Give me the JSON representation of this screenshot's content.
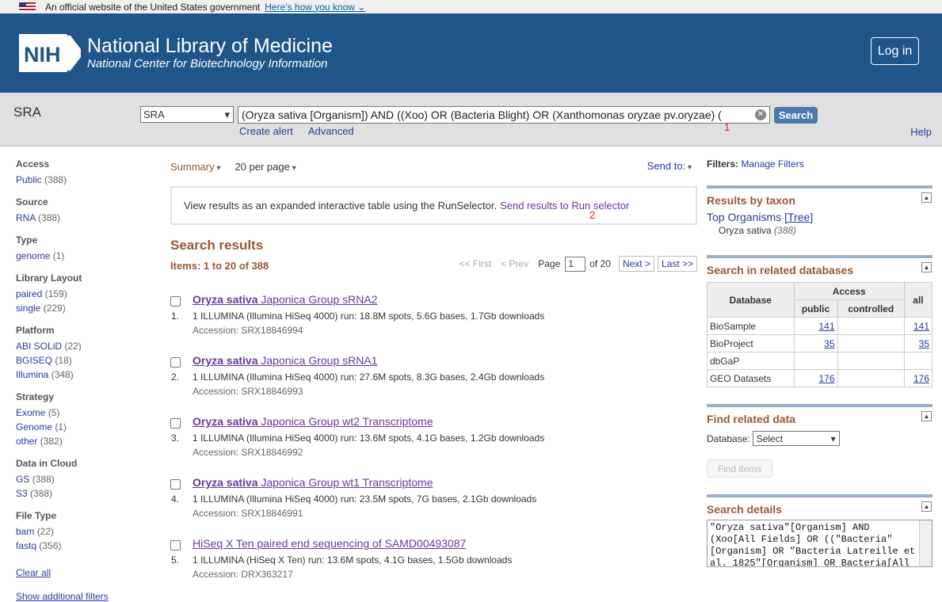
{
  "gov_banner": {
    "text": "An official website of the United States government",
    "link": "Here's how you know"
  },
  "header": {
    "logo_text": "NIH",
    "title": "National Library of Medicine",
    "subtitle": "National Center for Biotechnology Information",
    "login": "Log in"
  },
  "search": {
    "db_label": "SRA",
    "db_selected": "SRA",
    "term": "(Oryza sativa [Organism]) AND ((Xoo) OR (Bacteria Blight) OR (Xanthomonas oryzae pv.oryzae) (",
    "button": "Search",
    "create_alert": "Create alert",
    "advanced": "Advanced",
    "help": "Help",
    "marker1": "1",
    "marker2": "2"
  },
  "filters": [
    {
      "heading": "Access",
      "items": [
        {
          "label": "Public",
          "count": "(388)"
        }
      ]
    },
    {
      "heading": "Source",
      "items": [
        {
          "label": "RNA",
          "count": "(388)"
        }
      ]
    },
    {
      "heading": "Type",
      "items": [
        {
          "label": "genome",
          "count": "(1)"
        }
      ]
    },
    {
      "heading": "Library Layout",
      "items": [
        {
          "label": "paired",
          "count": "(159)"
        },
        {
          "label": "single",
          "count": "(229)"
        }
      ]
    },
    {
      "heading": "Platform",
      "items": [
        {
          "label": "ABI SOLiD",
          "count": "(22)"
        },
        {
          "label": "BGISEQ",
          "count": "(18)"
        },
        {
          "label": "Illumina",
          "count": "(348)"
        }
      ]
    },
    {
      "heading": "Strategy",
      "items": [
        {
          "label": "Exome",
          "count": "(5)"
        },
        {
          "label": "Genome",
          "count": "(1)"
        },
        {
          "label": "other",
          "count": "(382)"
        }
      ]
    },
    {
      "heading": "Data in Cloud",
      "items": [
        {
          "label": "GS",
          "count": "(388)"
        },
        {
          "label": "S3",
          "count": "(388)"
        }
      ]
    },
    {
      "heading": "File Type",
      "items": [
        {
          "label": "bam",
          "count": "(22)"
        },
        {
          "label": "fastq",
          "count": "(356)"
        }
      ]
    }
  ],
  "left_links": {
    "clear_all": "Clear all",
    "show_more": "Show additional filters"
  },
  "toolbar": {
    "summary": "Summary",
    "per_page": "20 per page",
    "send_to": "Send to:"
  },
  "runselector": {
    "text": "View results as an expanded interactive table using the RunSelector.",
    "link": "Send results to Run selector"
  },
  "results_heading": "Search results",
  "items_text": "Items: 1 to 20 of 388",
  "pager": {
    "first": "<< First",
    "prev": "< Prev",
    "page_label": "Page",
    "page": "1",
    "of": "of 20",
    "next": "Next >",
    "last": "Last >>"
  },
  "results": [
    {
      "num": "1.",
      "title_bold": "Oryza sativa",
      "title_rest": " Japonica Group sRNA2",
      "desc": "1 ILLUMINA (Illumina HiSeq 4000) run: 18.8M spots, 5.6G bases, 1.7Gb downloads",
      "acc": "Accession: SRX18846994"
    },
    {
      "num": "2.",
      "title_bold": "Oryza sativa",
      "title_rest": " Japonica Group sRNA1",
      "desc": "1 ILLUMINA (Illumina HiSeq 4000) run: 27.6M spots, 8.3G bases, 2.4Gb downloads",
      "acc": "Accession: SRX18846993"
    },
    {
      "num": "3.",
      "title_bold": "Oryza sativa",
      "title_rest": " Japonica Group wt2 Transcriptome",
      "desc": "1 ILLUMINA (Illumina HiSeq 4000) run: 13.6M spots, 4.1G bases, 1.2Gb downloads",
      "acc": "Accession: SRX18846992"
    },
    {
      "num": "4.",
      "title_bold": "Oryza sativa",
      "title_rest": " Japonica Group wt1 Transcriptome",
      "desc": "1 ILLUMINA (Illumina HiSeq 4000) run: 23.5M spots, 7G bases, 2.1Gb downloads",
      "acc": "Accession: SRX18846991"
    },
    {
      "num": "5.",
      "title_bold": "",
      "title_rest": "HiSeq X Ten paired end sequencing of SAMD00493087",
      "desc": "1 ILLUMINA (HiSeq X Ten) run: 13.6M spots, 4.1G bases, 1.5Gb downloads",
      "acc": "Accession: DRX363217"
    }
  ],
  "right": {
    "filters_label": "Filters:",
    "manage_filters": "Manage Filters",
    "taxon_heading": "Results by taxon",
    "top_organisms": "Top Organisms",
    "tree": "[Tree]",
    "organism": "Oryza sativa",
    "organism_count": "(388)",
    "related_heading": "Search in related databases",
    "table_headers": {
      "database": "Database",
      "access": "Access",
      "all": "all",
      "public": "public",
      "controlled": "controlled"
    },
    "related_rows": [
      {
        "db": "BioSample",
        "public": "141",
        "controlled": "",
        "all": "141"
      },
      {
        "db": "BioProject",
        "public": "35",
        "controlled": "",
        "all": "35"
      },
      {
        "db": "dbGaP",
        "public": "",
        "controlled": "",
        "all": ""
      },
      {
        "db": "GEO Datasets",
        "public": "176",
        "controlled": "",
        "all": "176"
      }
    ],
    "find_heading": "Find related data",
    "database_label": "Database:",
    "database_select": "Select",
    "find_items": "Find items",
    "details_heading": "Search details",
    "details_text": "\"Oryza sativa\"[Organism] AND (Xoo[All Fields] OR ((\"Bacteria\"[Organism] OR \"Bacteria Latreille et al. 1825\"[Organism] OR Bacteria[All Fields])"
  },
  "colors": {
    "header_bg": "#20558a",
    "accent_brown": "#985735",
    "link": "#2a3a99",
    "visited": "#66399a",
    "search_btn": "#4a7aab"
  }
}
